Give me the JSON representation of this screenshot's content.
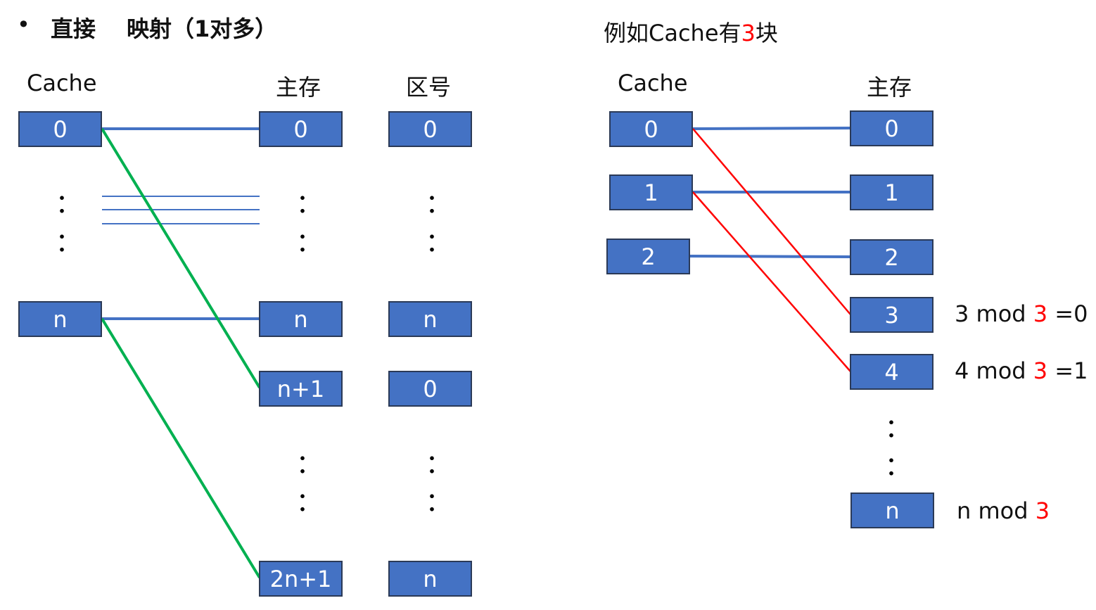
{
  "left": {
    "bullet": "•",
    "title_part1": "直接",
    "title_part2": "映射（1对多）",
    "cache_header": "Cache",
    "memory_header": "主存",
    "zone_header": "区号",
    "cache_blocks": [
      "0",
      "n"
    ],
    "memory_blocks": [
      "0",
      "n",
      "n+1",
      "2n+1"
    ],
    "zone_blocks": [
      "0",
      "n",
      "0",
      "n"
    ]
  },
  "right": {
    "example_prefix": "例如Cache有",
    "example_number": "3",
    "example_suffix": "块",
    "cache_header": "Cache",
    "memory_header": "主存",
    "cache_blocks": [
      "0",
      "1",
      "2"
    ],
    "memory_blocks": [
      "0",
      "1",
      "2",
      "3",
      "4",
      "n"
    ],
    "mod_rows": [
      {
        "lhs": "3 mod ",
        "num": "3",
        "rhs": " =0"
      },
      {
        "lhs": "4 mod ",
        "num": "3",
        "rhs": " =1"
      },
      {
        "lhs": "n mod ",
        "num": "3",
        "rhs": ""
      }
    ]
  },
  "colors": {
    "block_fill": "#4472c4",
    "block_border": "#2b3a57",
    "link_blue": "#4472c4",
    "link_green": "#00b050",
    "link_red": "#ff0000",
    "highlight_red": "#ff0000"
  }
}
